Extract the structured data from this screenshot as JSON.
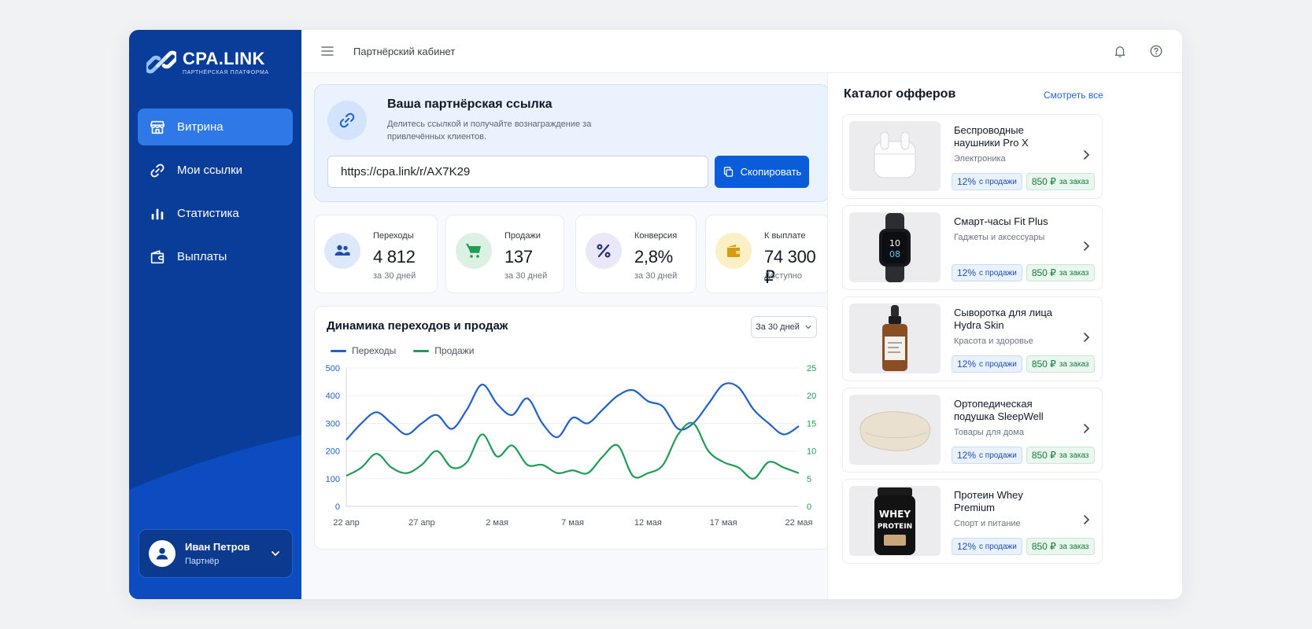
{
  "brand": {
    "name": "CPA.LINK",
    "tagline": "ПАРТНЁРСКАЯ ПЛАТФОРМА"
  },
  "sidebar": {
    "items": [
      {
        "label": "Витрина",
        "icon": "storefront-icon",
        "active": true
      },
      {
        "label": "Мои ссылки",
        "icon": "link-icon"
      },
      {
        "label": "Статистика",
        "icon": "bar-chart-icon"
      },
      {
        "label": "Выплаты",
        "icon": "wallet-icon"
      }
    ],
    "user": {
      "name": "Иван Петров",
      "role": "Партнёр"
    }
  },
  "topbar": {
    "title": "Партнёрский кабинет"
  },
  "referral": {
    "title": "Ваша партнёрская ссылка",
    "description": "Делитесь ссылкой и получайте вознаграждение за привлечённых клиентов.",
    "url": "https://cpa.link/r/AX7K29",
    "copy_label": "Скопировать"
  },
  "stats": [
    {
      "label": "Переходы",
      "value": "4 812",
      "sub": "за 30 дней",
      "icon": "users-icon",
      "color": "#2f6fdc"
    },
    {
      "label": "Продажи",
      "value": "137",
      "sub": "за 30 дней",
      "icon": "cart-icon",
      "color": "#1f9d55"
    },
    {
      "label": "Конверсия",
      "value": "2,8%",
      "sub": "за 30 дней",
      "icon": "percent-icon",
      "color": "#3b3f8f"
    },
    {
      "label": "К выплате",
      "value": "74 300 ₽",
      "sub": "Доступно",
      "icon": "wallet-icon",
      "color": "#d79a10"
    }
  ],
  "chart_panel": {
    "title": "Динамика переходов и продаж",
    "period": "За 30 дней"
  },
  "chart_data": {
    "type": "line",
    "x": [
      "22 апр",
      "23 апр",
      "24 апр",
      "25 апр",
      "26 апр",
      "27 апр",
      "28 апр",
      "29 апр",
      "30 апр",
      "1 мая",
      "2 мая",
      "3 мая",
      "4 мая",
      "5 мая",
      "6 мая",
      "7 мая",
      "8 мая",
      "9 мая",
      "10 мая",
      "11 мая",
      "12 мая",
      "13 мая",
      "14 мая",
      "15 мая",
      "16 мая",
      "17 мая",
      "18 мая",
      "19 мая",
      "20 мая",
      "21 мая",
      "22 мая"
    ],
    "tick_labels": [
      "22 апр",
      "27 апр",
      "2 мая",
      "7 мая",
      "12 мая",
      "17 мая",
      "22 мая"
    ],
    "series": [
      {
        "name": "Переходы",
        "axis": "left",
        "color": "#1f5fd0",
        "values": [
          240,
          300,
          340,
          300,
          260,
          300,
          330,
          280,
          350,
          440,
          370,
          330,
          390,
          300,
          250,
          320,
          300,
          350,
          400,
          420,
          380,
          360,
          280,
          300,
          370,
          440,
          430,
          350,
          300,
          260,
          290
        ]
      },
      {
        "name": "Продажи",
        "axis": "right",
        "color": "#1f9d55",
        "values": [
          5.5,
          7,
          9.5,
          7,
          6,
          7.5,
          10,
          7,
          8,
          13,
          9,
          11,
          7.5,
          7.5,
          6,
          6.5,
          6,
          9,
          11,
          5.5,
          6,
          7.5,
          13,
          15,
          10,
          8,
          7,
          5,
          8,
          7,
          6
        ]
      }
    ],
    "y_left": {
      "ticks": [
        0,
        100,
        200,
        300,
        400,
        500
      ],
      "range": [
        0,
        500
      ]
    },
    "y_right": {
      "ticks": [
        0,
        5,
        10,
        15,
        20,
        25
      ],
      "range": [
        0,
        25
      ]
    },
    "grid": true,
    "legend": "top-left"
  },
  "catalog": {
    "title": "Каталог офферов",
    "view_all": "Смотреть все",
    "offers": [
      {
        "name": "Беспроводные наушники Pro X",
        "category": "Электроника",
        "percent": "12%",
        "percent_note": "с продажи",
        "reward": "850 ₽",
        "reward_note": "за заказ",
        "image": "earbuds-icon"
      },
      {
        "name": "Смарт-часы Fit Plus",
        "category": "Гаджеты и аксессуары",
        "percent": "12%",
        "percent_note": "с продажи",
        "reward": "850 ₽",
        "reward_note": "за заказ",
        "image": "smartwatch-icon",
        "watch_face": "10 08"
      },
      {
        "name": "Сыворотка для лица Hydra Skin",
        "category": "Красота и здоровье",
        "percent": "12%",
        "percent_note": "с продажи",
        "reward": "850 ₽",
        "reward_note": "за заказ",
        "image": "serum-bottle-icon"
      },
      {
        "name": "Ортопедическая подушка SleepWell",
        "category": "Товары для дома",
        "percent": "12%",
        "percent_note": "с продажи",
        "reward": "850 ₽",
        "reward_note": "за заказ",
        "image": "pillow-icon"
      },
      {
        "name": "Протеин Whey Premium",
        "category": "Спорт и питание",
        "percent": "12%",
        "percent_note": "с продажи",
        "reward": "850 ₽",
        "reward_note": "за заказ",
        "image": "protein-jar-icon",
        "jar_label": "WHEY PROTEIN"
      }
    ]
  }
}
